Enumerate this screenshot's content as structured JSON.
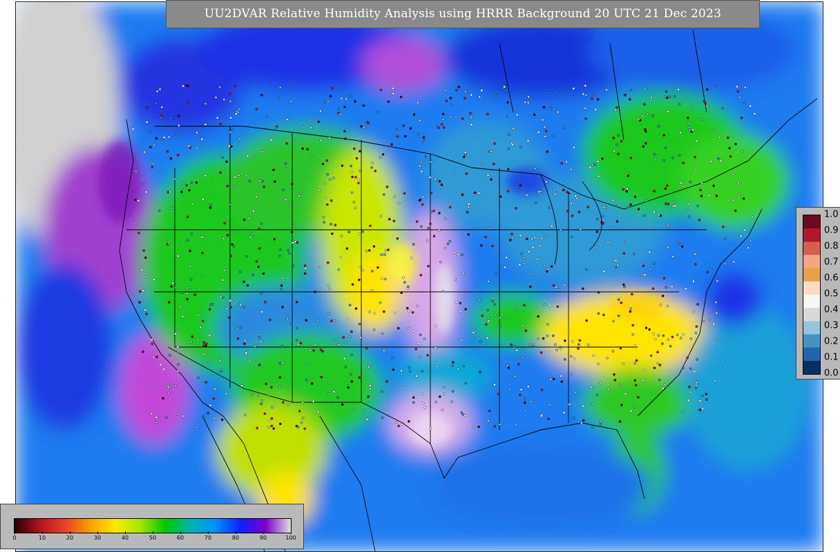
{
  "title": "UU2DVAR Relative Humidity Analysis using HRRR Background 20 UTC 21 Dec 2023",
  "rh_colorbar": {
    "ticks": [
      "0",
      "10",
      "20",
      "30",
      "40",
      "50",
      "60",
      "70",
      "80",
      "90",
      "100"
    ],
    "colors": [
      "#2b0000",
      "#b0141e",
      "#e8402a",
      "#f5a000",
      "#ffe800",
      "#a6e600",
      "#00c800",
      "#00b4b4",
      "#0090ff",
      "#1020ff",
      "#7a00c8",
      "#e0e0e0"
    ]
  },
  "obs_colorbar": {
    "ticks": [
      "1.0",
      "0.9",
      "0.8",
      "0.7",
      "0.6",
      "0.5",
      "0.4",
      "0.3",
      "0.2",
      "0.1",
      "0.0"
    ],
    "colors": [
      "#6b0a1e",
      "#b2182b",
      "#d6604d",
      "#f4a582",
      "#e9a04a",
      "#fddbc7",
      "#f7f7f7",
      "#d9d9d9",
      "#92c5de",
      "#4393c3",
      "#2166ac",
      "#053061"
    ]
  }
}
